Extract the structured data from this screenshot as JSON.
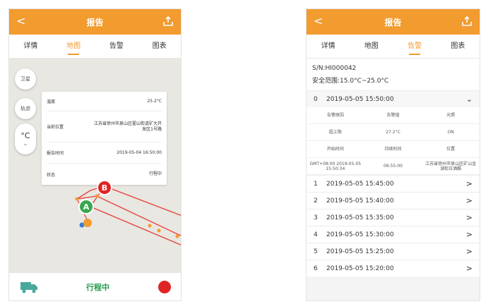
{
  "left": {
    "title": "报告",
    "back_label": "<",
    "tabs": [
      "详情",
      "地图",
      "告警",
      "图表"
    ],
    "active_tab": 1,
    "map_buttons": [
      "卫星",
      "轨迹"
    ],
    "unit": {
      "symbol": "°C",
      "caret": "⌄"
    },
    "info": [
      {
        "label": "温度",
        "value": "25.2°C"
      },
      {
        "label": "当前位置",
        "value": "江苏省徐州市泉山区翟山街道矿大开发区1号路"
      },
      {
        "label": "报告时间",
        "value": "2019-05-04 16:50:00"
      },
      {
        "label": "状态",
        "value": "行程中"
      }
    ],
    "markers": {
      "start": "A",
      "end": "B"
    },
    "status": "行程中",
    "colors": {
      "accent": "#f29b2f",
      "green": "#2a9b4e",
      "red": "#e02424",
      "route": "#e8453c"
    }
  },
  "right": {
    "title": "报告",
    "back_label": "<",
    "tabs": [
      "详情",
      "地图",
      "告警",
      "图表"
    ],
    "active_tab": 2,
    "sn": "S/N:HI000042",
    "range": "安全范围:15.0°C~25.0°C",
    "expanded": {
      "index": "0",
      "date": "2019-05-05 15:50:00",
      "chev": "⌄",
      "headers": [
        "告警原因",
        "告警值",
        "光照"
      ],
      "values": [
        "超上限",
        "27.2°C",
        "ON"
      ],
      "headers2": [
        "开始时间",
        "持续时间",
        "位置"
      ],
      "values2": [
        "GMT+08:00 2019-05-05 15:50:34",
        "06:55:00",
        "江苏省徐州市泉山区矿山金湖街日酒酷"
      ]
    },
    "rows": [
      {
        "index": "1",
        "date": "2019-05-05 15:45:00"
      },
      {
        "index": "2",
        "date": "2019-05-05 15:40:00"
      },
      {
        "index": "3",
        "date": "2019-05-05 15:35:00"
      },
      {
        "index": "4",
        "date": "2019-05-05 15:30:00"
      },
      {
        "index": "5",
        "date": "2019-05-05 15:25:00"
      },
      {
        "index": "6",
        "date": "2019-05-05 15:20:00"
      }
    ],
    "row_chev": ">"
  }
}
